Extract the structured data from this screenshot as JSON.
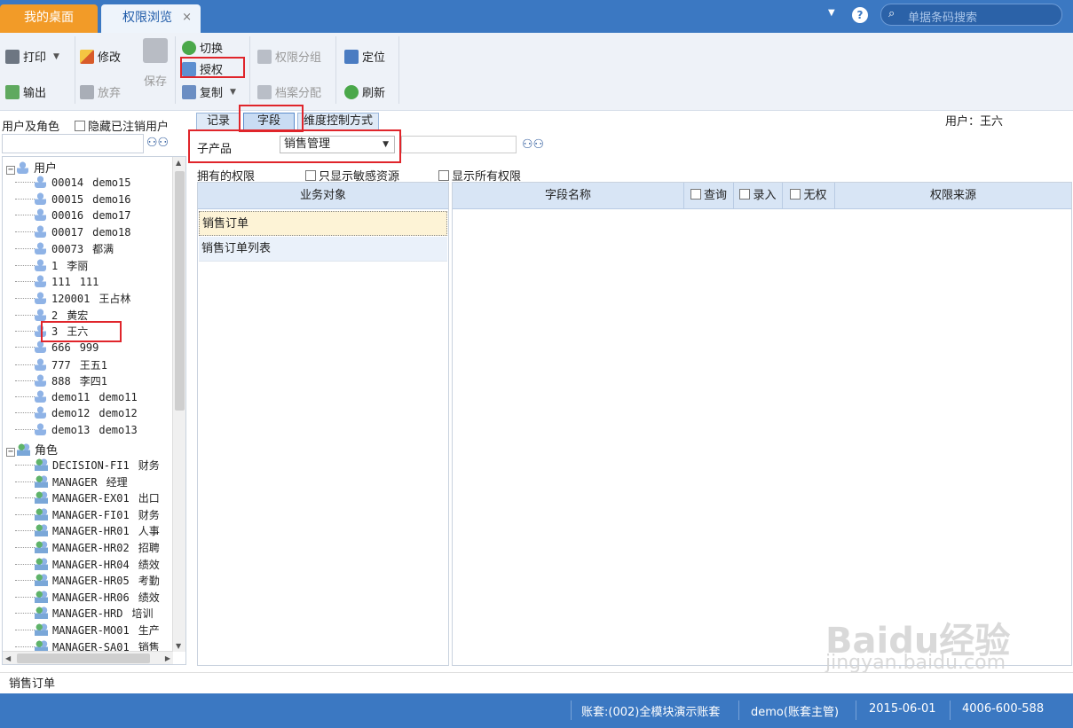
{
  "tabs": {
    "home": "我的桌面",
    "active": "权限浏览",
    "close": "×"
  },
  "header": {
    "help": "?",
    "search_placeholder": "单据条码搜索"
  },
  "toolbar": {
    "print": "打印",
    "export": "输出",
    "edit": "修改",
    "abandon": "放弃",
    "save": "保存",
    "switch": "切换",
    "grant": "授权",
    "copy": "复制",
    "perm_group": "权限分组",
    "archive_assign": "档案分配",
    "locate": "定位",
    "refresh": "刷新"
  },
  "left": {
    "title": "用户及角色",
    "hide_cancelled": "隐藏已注销用户",
    "users_node": "用户",
    "roles_node": "角色",
    "users": [
      {
        "code": "00014",
        "name": "demo15"
      },
      {
        "code": "00015",
        "name": "demo16"
      },
      {
        "code": "00016",
        "name": "demo17"
      },
      {
        "code": "00017",
        "name": "demo18"
      },
      {
        "code": "00073",
        "name": "都满"
      },
      {
        "code": "1",
        "name": "李丽"
      },
      {
        "code": "111",
        "name": "111"
      },
      {
        "code": "120001",
        "name": "王占林"
      },
      {
        "code": "2",
        "name": "黄宏"
      },
      {
        "code": "3",
        "name": "王六"
      },
      {
        "code": "666",
        "name": "999"
      },
      {
        "code": "777",
        "name": "王五1"
      },
      {
        "code": "888",
        "name": "李四1"
      },
      {
        "code": "demo11",
        "name": "demo11"
      },
      {
        "code": "demo12",
        "name": "demo12"
      },
      {
        "code": "demo13",
        "name": "demo13"
      }
    ],
    "roles": [
      {
        "code": "DECISION-FI1",
        "name": "财务"
      },
      {
        "code": "MANAGER",
        "name": "经理"
      },
      {
        "code": "MANAGER-EX01",
        "name": "出口"
      },
      {
        "code": "MANAGER-FI01",
        "name": "财务"
      },
      {
        "code": "MANAGER-HR01",
        "name": "人事"
      },
      {
        "code": "MANAGER-HR02",
        "name": "招聘"
      },
      {
        "code": "MANAGER-HR04",
        "name": "绩效"
      },
      {
        "code": "MANAGER-HR05",
        "name": "考勤"
      },
      {
        "code": "MANAGER-HR06",
        "name": "绩效"
      },
      {
        "code": "MANAGER-HRD",
        "name": "培训"
      },
      {
        "code": "MANAGER-MO01",
        "name": "生产"
      },
      {
        "code": "MANAGER-SA01",
        "name": "销售"
      }
    ]
  },
  "subtabs": [
    "记录",
    "字段",
    "维度控制方式"
  ],
  "user_label": "用户：王六",
  "sub_product": {
    "label": "子产品",
    "value": "销售管理"
  },
  "own_perms": {
    "label": "拥有的权限",
    "only_sensitive": "只显示敏感资源",
    "show_all": "显示所有权限"
  },
  "object_pane": {
    "header": "业务对象",
    "rows": [
      "销售订单",
      "销售订单列表"
    ]
  },
  "field_pane": {
    "name": "字段名称",
    "query": "查询",
    "entry": "录入",
    "none": "无权",
    "source": "权限来源"
  },
  "status_text": "销售订单",
  "statusbar": {
    "account": "账套:(002)全模块演示账套",
    "user": "demo(账套主管)",
    "date": "2015-06-01",
    "phone": "4006-600-588"
  },
  "watermark": {
    "brand": "Baidu经验",
    "url": "jingyan.baidu.com"
  }
}
